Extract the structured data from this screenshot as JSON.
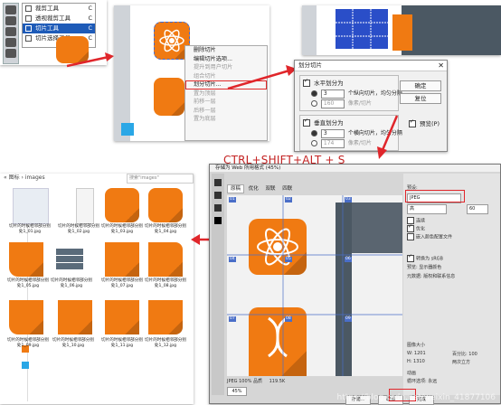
{
  "tools_flyout": {
    "items": [
      {
        "label": "裁剪工具",
        "key": "C"
      },
      {
        "label": "透视裁剪工具",
        "key": "C"
      },
      {
        "label": "切片工具",
        "key": "C",
        "selected": true
      },
      {
        "label": "切片选择工具",
        "key": "C"
      }
    ]
  },
  "context_menu": {
    "items": [
      {
        "label": "删除切片",
        "dim": false
      },
      {
        "label": "编辑切片选项...",
        "dim": false
      },
      {
        "label": "提升到用户切片",
        "dim": true
      },
      {
        "label": "组合切片",
        "dim": true
      },
      {
        "label": "划分切片...",
        "dim": false,
        "highlighted": true
      },
      {
        "label": "置为顶层",
        "dim": true
      },
      {
        "label": "前移一层",
        "dim": true
      },
      {
        "label": "后移一层",
        "dim": true
      },
      {
        "label": "置为底层",
        "dim": true
      }
    ]
  },
  "divide_dialog": {
    "title": "划分切片",
    "horizontal_label": "水平划分为",
    "h_rows_value": "3",
    "h_rows_text": "个纵向切片，均匀分隔",
    "h_px_value": "160",
    "h_px_text": "像素/切片",
    "vertical_label": "垂直划分为",
    "v_rows_value": "3",
    "v_rows_text": "个横向切片，均匀分隔",
    "v_px_value": "174",
    "v_px_text": "像素/切片",
    "ok_label": "确定",
    "reset_label": "复位",
    "preview_label": "预览(P)"
  },
  "shortcut_caption": "CTRL+SHIFT+ALT + S",
  "explorer": {
    "path": "« 图标 › images",
    "search_placeholder": "搜索\"images\"",
    "files": [
      "切片的时候相邻部分别处1_01.jpg",
      "切片的时候相邻部分别处1_02.jpg",
      "切片的时候相邻部分别处1_03.jpg",
      "切片的时候相邻部分别处1_04.jpg",
      "切片的时候相邻部分别处1_05.jpg",
      "切片的时候相邻部分别处1_06.jpg",
      "切片的时候相邻部分别处1_07.jpg",
      "切片的时候相邻部分别处1_08.jpg",
      "切片的时候相邻部分别处1_09.jpg",
      "切片的时候相邻部分别处1_10.jpg",
      "切片的时候相邻部分别处1_11.jpg",
      "切片的时候相邻部分别处1_12.jpg"
    ]
  },
  "save_for_web": {
    "title": "存储为 Web 所用格式 (45%)",
    "tabs": [
      "原稿",
      "优化",
      "双联",
      "四联"
    ],
    "preset_label": "预设:",
    "format_value": "JPEG",
    "quality_value": "高",
    "quality_number": "60",
    "checkbox_labels": [
      "连续",
      "优化",
      "嵌入颜色配置文件"
    ],
    "color_label": "转换为 sRGB",
    "preview_label": "预览: 显示器颜色",
    "metadata_label": "元数据: 版权和联系信息",
    "image_size_label": "图像大小",
    "width_label": "W: 1201",
    "height_label": "H: 1310",
    "percent_label": "百分比: 100",
    "quality_method": "两次立方",
    "animation_label": "动画",
    "loop_label": "循环选项: 永远",
    "zoom_value": "45%",
    "footer_status": "JPEG 100% 品质",
    "footer_size": "119.5K",
    "save_label": "存储...",
    "cancel_label": "取消",
    "done_label": "完成",
    "slice_labels": [
      "01",
      "02",
      "03",
      "04",
      "05",
      "06",
      "07",
      "08",
      "09"
    ]
  },
  "watermark": "https://blog.csdn.net/weixin_41877106",
  "colors": {
    "accent_orange": "#f07a12",
    "arrow_red": "#e0262b",
    "slice_blue": "#4a6ec8",
    "slate": "#4b5863"
  }
}
